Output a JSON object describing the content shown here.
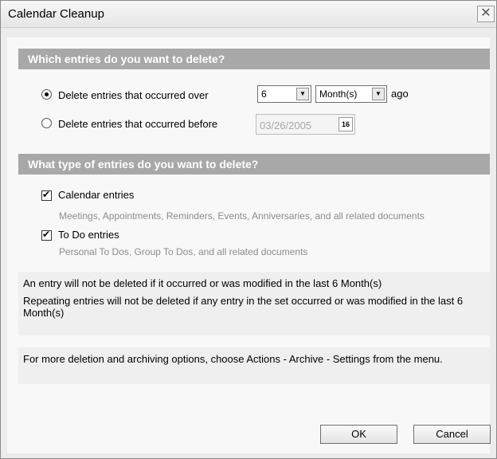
{
  "window": {
    "title": "Calendar Cleanup",
    "close_glyph": "✕"
  },
  "section1": {
    "header": "Which entries do you want to delete?",
    "option_over": {
      "label": "Delete entries that occurred over",
      "selected": true,
      "amount": "6",
      "unit": "Month(s)",
      "suffix": "ago"
    },
    "option_before": {
      "label": "Delete entries that occurred before",
      "selected": false,
      "date": "03/26/2005",
      "calendar_glyph": "16"
    }
  },
  "section2": {
    "header": "What type of entries do you want to delete?",
    "calendar_entries": {
      "label": "Calendar entries",
      "checked": true,
      "description": "Meetings, Appointments, Reminders, Events, Anniversaries, and all related documents"
    },
    "todo_entries": {
      "label": "To Do entries",
      "checked": true,
      "description": "Personal To Dos, Group To Dos, and all related documents"
    }
  },
  "info": {
    "line1": "An entry will not be deleted if it occurred or was modified in the last 6 Month(s)",
    "line2": "Repeating entries will not be deleted if any entry in the set occurred or was modified in the last 6 Month(s)"
  },
  "tip": {
    "text": "For more deletion and archiving options, choose Actions - Archive - Settings from the menu."
  },
  "buttons": {
    "ok": "OK",
    "cancel": "Cancel"
  }
}
